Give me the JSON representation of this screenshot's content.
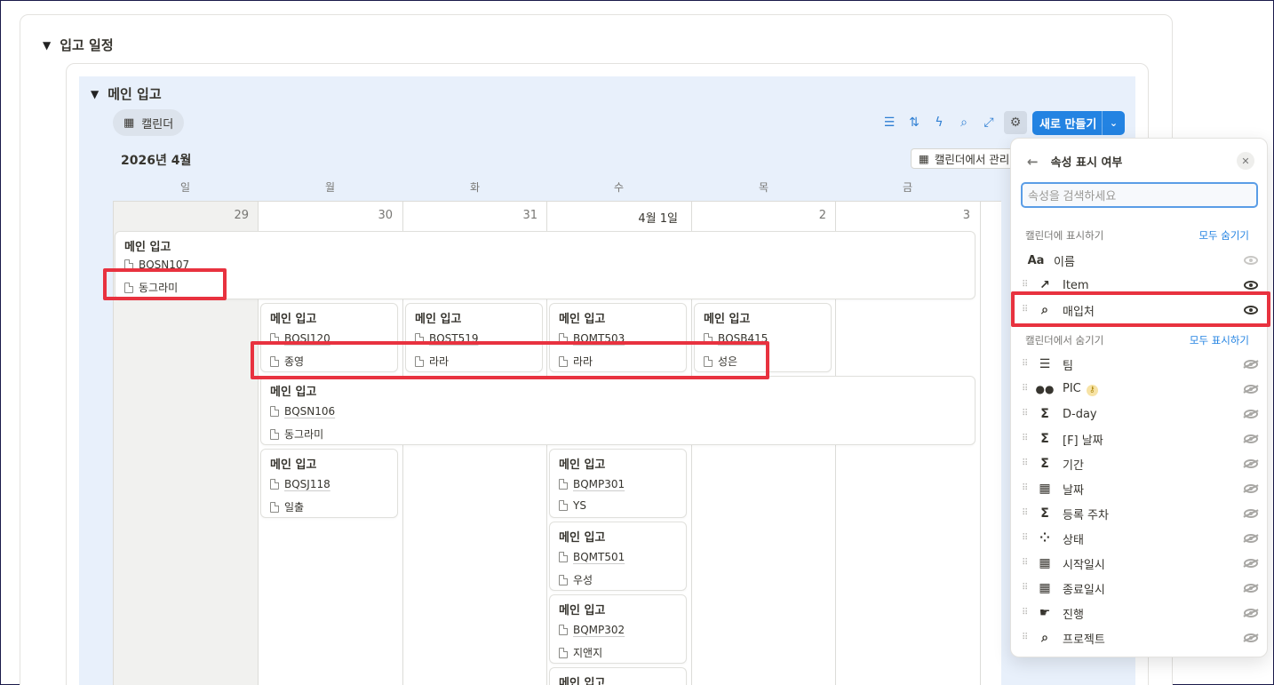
{
  "section": {
    "title": "입고 일정"
  },
  "view": {
    "title": "메인 입고",
    "tab_label": "캘린더"
  },
  "toolbar": {
    "new_label": "새로 만들기"
  },
  "calendar": {
    "month_label": "2026년 4월",
    "manage_label": "캘린더에서 관리",
    "weekdays": [
      "일",
      "월",
      "화",
      "수",
      "목",
      "금"
    ],
    "days": [
      "29",
      "30",
      "31",
      "4월 1일",
      "2",
      "3"
    ],
    "events": [
      {
        "title": "메인 입고",
        "code": "BQSN107",
        "owner": "동그라미"
      },
      {
        "title": "메인 입고",
        "code": "BQSJ120",
        "owner": "종영"
      },
      {
        "title": "메인 입고",
        "code": "BQST519",
        "owner": "라라"
      },
      {
        "title": "메인 입고",
        "code": "BQMT503",
        "owner": "라라"
      },
      {
        "title": "메인 입고",
        "code": "BQSB415",
        "owner": "성은"
      },
      {
        "title": "메인 입고",
        "code": "BQSN106",
        "owner": "동그라미"
      },
      {
        "title": "메인 입고",
        "code": "BQSJ118",
        "owner": "일출"
      },
      {
        "title": "메인 입고",
        "code": "BQMP301",
        "owner": "YS"
      },
      {
        "title": "메인 입고",
        "code": "BQMT501",
        "owner": "우성"
      },
      {
        "title": "메인 입고",
        "code": "BQMP302",
        "owner": "지앤지"
      },
      {
        "title": "메인 입고"
      }
    ]
  },
  "panel": {
    "title": "속성 표시 여부",
    "search_placeholder": "속성을 검색하세요",
    "shown_section": "캘린더에 표시하기",
    "hide_all": "모두 숨기기",
    "hidden_section": "캘린더에서 숨기기",
    "show_all": "모두 표시하기",
    "shown": [
      {
        "icon": "text-icon",
        "glyph": "Aa",
        "name": "이름"
      },
      {
        "icon": "arrow-up-right-icon",
        "glyph": "↗",
        "name": "Item"
      },
      {
        "icon": "search-icon",
        "glyph": "⌕",
        "name": "매입처"
      }
    ],
    "hidden": [
      {
        "icon": "list-icon",
        "glyph": "☰",
        "name": "팀"
      },
      {
        "icon": "people-icon",
        "glyph": "👥",
        "name": "PIC"
      },
      {
        "icon": "sigma-icon",
        "glyph": "Σ",
        "name": "D-day"
      },
      {
        "icon": "sigma-icon",
        "glyph": "Σ",
        "name": "[F] 날짜"
      },
      {
        "icon": "sigma-icon",
        "glyph": "Σ",
        "name": "기간"
      },
      {
        "icon": "calendar-icon",
        "glyph": "▦",
        "name": "날짜"
      },
      {
        "icon": "sigma-icon",
        "glyph": "Σ",
        "name": "등록 주차"
      },
      {
        "icon": "status-icon",
        "glyph": "⁘",
        "name": "상태"
      },
      {
        "icon": "calendar-icon",
        "glyph": "▦",
        "name": "시작일시"
      },
      {
        "icon": "calendar-icon",
        "glyph": "▦",
        "name": "종료일시"
      },
      {
        "icon": "cursor-icon",
        "glyph": "☛",
        "name": "진행"
      },
      {
        "icon": "search-icon",
        "glyph": "⌕",
        "name": "프로젝트"
      }
    ]
  }
}
